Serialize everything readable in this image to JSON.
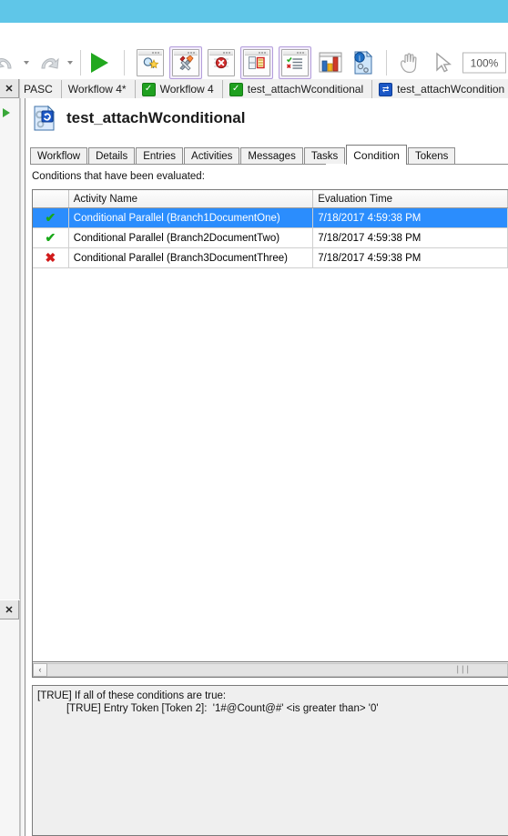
{
  "window": {
    "band_color": "#5FC6E8"
  },
  "toolbar": {
    "undo_label": "undo-arrow",
    "redo_label": "redo-arrow",
    "run_label": "run-workflow",
    "zoom_value": "100%",
    "buttons": [
      {
        "name": "find-activity",
        "icon": "magnifier-star-icon",
        "highlighted": false
      },
      {
        "name": "tools",
        "icon": "hammer-wrench-icon",
        "highlighted": true
      },
      {
        "name": "errors",
        "icon": "error-circle-icon",
        "highlighted": false
      },
      {
        "name": "properties",
        "icon": "panel-properties-icon",
        "highlighted": true
      },
      {
        "name": "checklist",
        "icon": "checklist-icon",
        "highlighted": true
      },
      {
        "name": "statistics",
        "icon": "bar-chart-icon",
        "highlighted": false
      },
      {
        "name": "information",
        "icon": "info-document-icon",
        "highlighted": false
      },
      {
        "name": "pan",
        "icon": "hand-icon",
        "highlighted": false
      },
      {
        "name": "select",
        "icon": "cursor-arrow-icon",
        "highlighted": false
      }
    ]
  },
  "document_tabs": {
    "close_label": "✕",
    "items": [
      {
        "label": "PASC",
        "icon": "none",
        "active": false
      },
      {
        "label": "Workflow 4*",
        "icon": "none",
        "active": false
      },
      {
        "label": "Workflow 4",
        "icon": "check-icon",
        "active": false
      },
      {
        "label": "test_attachWconditional",
        "icon": "check-icon",
        "active": false
      },
      {
        "label": "test_attachWcondition",
        "icon": "sync-icon",
        "active": true
      }
    ]
  },
  "left_rail": {
    "close_top_label": "✕",
    "close_bottom_label": "✕"
  },
  "document": {
    "icon": "workflow-instance-icon",
    "title": "test_attachWconditional"
  },
  "inner_tabs": {
    "items": [
      {
        "label": "Workflow",
        "active": false
      },
      {
        "label": "Details",
        "active": false
      },
      {
        "label": "Entries",
        "active": false
      },
      {
        "label": "Activities",
        "active": false
      },
      {
        "label": "Messages",
        "active": false
      },
      {
        "label": "Tasks",
        "active": false
      },
      {
        "label": "Condition",
        "active": true
      },
      {
        "label": "Tokens",
        "active": false
      }
    ]
  },
  "conditions_panel": {
    "label": "Conditions that have been evaluated:",
    "columns": [
      "",
      "Activity Name",
      "Evaluation Time"
    ],
    "rows": [
      {
        "status": "✔",
        "status_name": "passed",
        "activity_name": "Conditional Parallel (Branch1DocumentOne)",
        "evaluation_time": "7/18/2017 4:59:38 PM",
        "selected": true
      },
      {
        "status": "✔",
        "status_name": "passed",
        "activity_name": "Conditional Parallel (Branch2DocumentTwo)",
        "evaluation_time": "7/18/2017 4:59:38 PM",
        "selected": false
      },
      {
        "status": "✖",
        "status_name": "failed",
        "activity_name": "Conditional Parallel (Branch3DocumentThree)",
        "evaluation_time": "7/18/2017 4:59:38 PM",
        "selected": false
      }
    ],
    "scroll_left_label": "‹",
    "scroll_grip_label": "∣∣∣"
  },
  "detail_pane": {
    "text": "[TRUE] If all of these conditions are true:\n          [TRUE] Entry Token [Token 2]:  '1#@Count@#' <is greater than> '0'"
  },
  "colors": {
    "selection_blue": "#2b8dfd",
    "success_green": "#1aa81a",
    "failure_red": "#d11b1b",
    "highlight_purple": "#b39ddb"
  }
}
